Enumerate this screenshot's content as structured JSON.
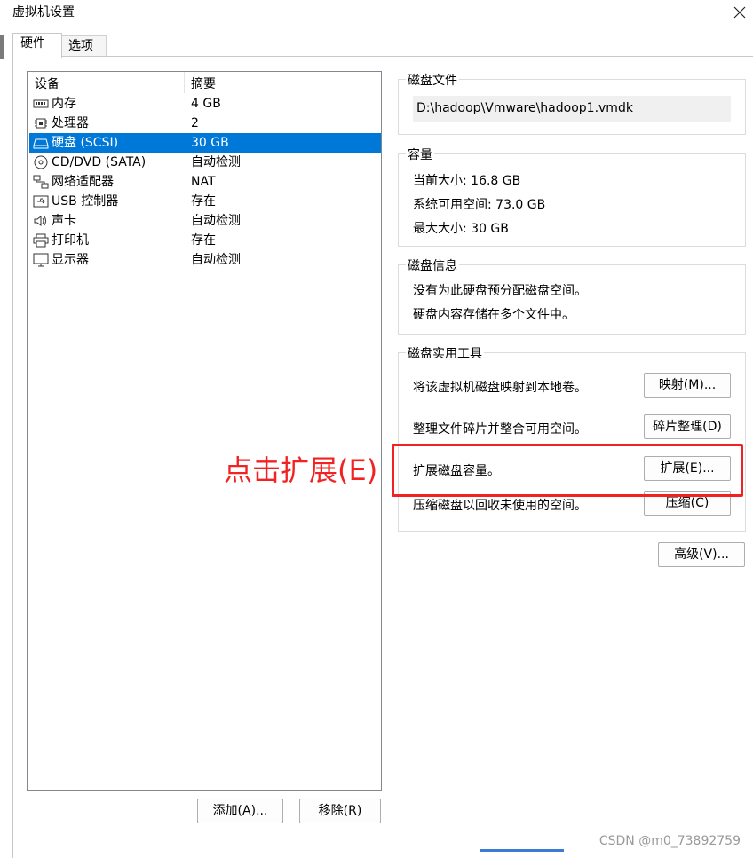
{
  "window": {
    "title": "虚拟机设置",
    "close_glyph": "✕"
  },
  "tabs": [
    {
      "label": "硬件",
      "active": true
    },
    {
      "label": "选项",
      "active": false
    }
  ],
  "device_list": {
    "columns": {
      "device": "设备",
      "summary": "摘要"
    },
    "rows": [
      {
        "name": "内存",
        "summary": "4 GB",
        "icon": "memory-icon"
      },
      {
        "name": "处理器",
        "summary": "2",
        "icon": "processor-icon"
      },
      {
        "name": "硬盘 (SCSI)",
        "summary": "30 GB",
        "icon": "hard-disk-icon",
        "selected": true
      },
      {
        "name": "CD/DVD (SATA)",
        "summary": "自动检测",
        "icon": "cd-dvd-icon"
      },
      {
        "name": "网络适配器",
        "summary": "NAT",
        "icon": "network-adapter-icon"
      },
      {
        "name": "USB 控制器",
        "summary": "存在",
        "icon": "usb-icon"
      },
      {
        "name": "声卡",
        "summary": "自动检测",
        "icon": "speaker-icon"
      },
      {
        "name": "打印机",
        "summary": "存在",
        "icon": "printer-icon"
      },
      {
        "name": "显示器",
        "summary": "自动检测",
        "icon": "monitor-icon"
      }
    ],
    "add_button": "添加(A)...",
    "remove_button": "移除(R)"
  },
  "disk_file": {
    "title": "磁盘文件",
    "path": "D:\\hadoop\\Vmware\\hadoop1.vmdk"
  },
  "capacity": {
    "title": "容量",
    "current_size": "当前大小: 16.8 GB",
    "system_free": "系统可用空间: 73.0 GB",
    "max_size": "最大大小: 30 GB"
  },
  "disk_info": {
    "title": "磁盘信息",
    "line1": "没有为此硬盘预分配磁盘空间。",
    "line2": "硬盘内容存储在多个文件中。"
  },
  "disk_utilities": {
    "title": "磁盘实用工具",
    "map_desc": "将该虚拟机磁盘映射到本地卷。",
    "map_button": "映射(M)...",
    "defrag_desc": "整理文件碎片并整合可用空间。",
    "defrag_button": "碎片整理(D)",
    "expand_desc": "扩展磁盘容量。",
    "expand_button": "扩展(E)...",
    "compact_desc": "压缩磁盘以回收未使用的空间。",
    "compact_button": "压缩(C)"
  },
  "advanced_button": "高级(V)...",
  "annotation": "点击扩展(E)",
  "watermark": "CSDN @m0_73892759",
  "colors": {
    "selection": "#0078d7",
    "annotation_red": "#f22222"
  }
}
